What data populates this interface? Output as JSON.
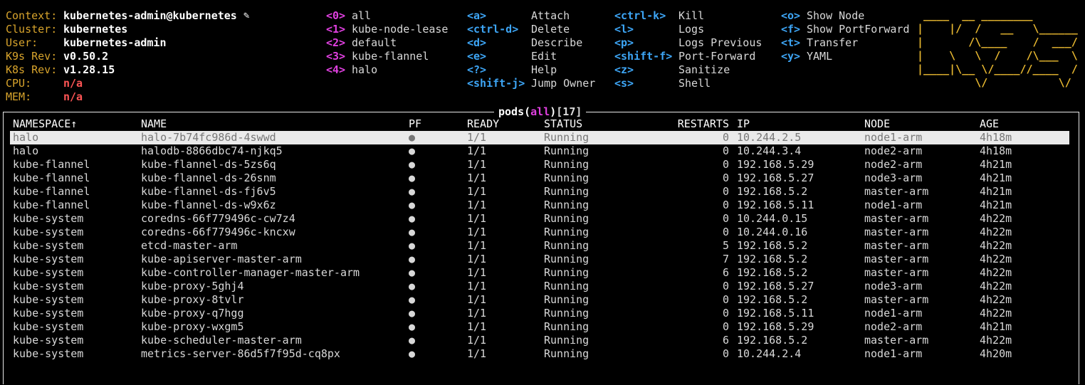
{
  "info": [
    {
      "label": "Context:",
      "value": "kubernetes-admin@kubernetes",
      "color": "white"
    },
    {
      "label": "Cluster:",
      "value": "kubernetes",
      "color": "white"
    },
    {
      "label": "User:",
      "value": "kubernetes-admin",
      "color": "white"
    },
    {
      "label": "K9s Rev:",
      "value": "v0.50.2",
      "color": "white"
    },
    {
      "label": "K8s Rev:",
      "value": "v1.28.15",
      "color": "white"
    },
    {
      "label": "CPU:",
      "value": "n/a",
      "color": "red"
    },
    {
      "label": "MEM:",
      "value": "n/a",
      "color": "red"
    }
  ],
  "icons": {
    "context_edit": "pencil-icon"
  },
  "namespaces": [
    {
      "key": "<0>",
      "name": "all"
    },
    {
      "key": "<1>",
      "name": "kube-node-lease"
    },
    {
      "key": "<2>",
      "name": "default"
    },
    {
      "key": "<3>",
      "name": "kube-flannel"
    },
    {
      "key": "<4>",
      "name": "halo"
    }
  ],
  "shortcuts_col1": [
    {
      "key": "<a>",
      "label": "Attach"
    },
    {
      "key": "<ctrl-d>",
      "label": "Delete"
    },
    {
      "key": "<d>",
      "label": "Describe"
    },
    {
      "key": "<e>",
      "label": "Edit"
    },
    {
      "key": "<?>",
      "label": "Help"
    },
    {
      "key": "<shift-j>",
      "label": "Jump Owner"
    }
  ],
  "shortcuts_col2": [
    {
      "key": "<ctrl-k>",
      "label": "Kill"
    },
    {
      "key": "<l>",
      "label": "Logs"
    },
    {
      "key": "<p>",
      "label": "Logs Previous"
    },
    {
      "key": "<shift-f>",
      "label": "Port-Forward"
    },
    {
      "key": "<z>",
      "label": "Sanitize"
    },
    {
      "key": "<s>",
      "label": "Shell"
    }
  ],
  "shortcuts_col3": [
    {
      "key": "<o>",
      "label": "Show Node"
    },
    {
      "key": "<f>",
      "label": "Show PortForward"
    },
    {
      "key": "<t>",
      "label": "Transfer"
    },
    {
      "key": "<y>",
      "label": "YAML"
    }
  ],
  "logo_lines": [
    " ____  __ ________       ",
    "|    |/  /   __   \\______",
    "|       /\\____    /  ___/",
    "|    \\   \\  /    /\\___  \\",
    "|____|\\__ \\/____//____  /",
    "         \\/           \\/ "
  ],
  "table": {
    "title_resource": "pods",
    "title_open": "(",
    "title_scope": "all",
    "title_close": ")",
    "title_count": "[17]",
    "sort_indicator": "↑",
    "columns": {
      "namespace": "NAMESPACE",
      "name": "NAME",
      "pf": "PF",
      "ready": "READY",
      "status": "STATUS",
      "restarts": "RESTARTS",
      "ip": "IP",
      "node": "NODE",
      "age": "AGE"
    },
    "selected_index": 0,
    "rows": [
      {
        "namespace": "halo",
        "name": "halo-7b74fc986d-4swwd",
        "pf": "●",
        "ready": "1/1",
        "status": "Running",
        "restarts": "0",
        "ip": "10.244.2.5",
        "node": "node1-arm",
        "age": "4h18m"
      },
      {
        "namespace": "halo",
        "name": "halodb-8866dbc74-njkq5",
        "pf": "●",
        "ready": "1/1",
        "status": "Running",
        "restarts": "0",
        "ip": "10.244.3.4",
        "node": "node2-arm",
        "age": "4h18m"
      },
      {
        "namespace": "kube-flannel",
        "name": "kube-flannel-ds-5zs6q",
        "pf": "●",
        "ready": "1/1",
        "status": "Running",
        "restarts": "0",
        "ip": "192.168.5.29",
        "node": "node2-arm",
        "age": "4h21m"
      },
      {
        "namespace": "kube-flannel",
        "name": "kube-flannel-ds-26snm",
        "pf": "●",
        "ready": "1/1",
        "status": "Running",
        "restarts": "0",
        "ip": "192.168.5.27",
        "node": "node3-arm",
        "age": "4h21m"
      },
      {
        "namespace": "kube-flannel",
        "name": "kube-flannel-ds-fj6v5",
        "pf": "●",
        "ready": "1/1",
        "status": "Running",
        "restarts": "0",
        "ip": "192.168.5.2",
        "node": "master-arm",
        "age": "4h21m"
      },
      {
        "namespace": "kube-flannel",
        "name": "kube-flannel-ds-w9x6z",
        "pf": "●",
        "ready": "1/1",
        "status": "Running",
        "restarts": "0",
        "ip": "192.168.5.11",
        "node": "node1-arm",
        "age": "4h21m"
      },
      {
        "namespace": "kube-system",
        "name": "coredns-66f779496c-cw7z4",
        "pf": "●",
        "ready": "1/1",
        "status": "Running",
        "restarts": "0",
        "ip": "10.244.0.15",
        "node": "master-arm",
        "age": "4h22m"
      },
      {
        "namespace": "kube-system",
        "name": "coredns-66f779496c-kncxw",
        "pf": "●",
        "ready": "1/1",
        "status": "Running",
        "restarts": "0",
        "ip": "10.244.0.16",
        "node": "master-arm",
        "age": "4h22m"
      },
      {
        "namespace": "kube-system",
        "name": "etcd-master-arm",
        "pf": "●",
        "ready": "1/1",
        "status": "Running",
        "restarts": "5",
        "ip": "192.168.5.2",
        "node": "master-arm",
        "age": "4h22m"
      },
      {
        "namespace": "kube-system",
        "name": "kube-apiserver-master-arm",
        "pf": "●",
        "ready": "1/1",
        "status": "Running",
        "restarts": "7",
        "ip": "192.168.5.2",
        "node": "master-arm",
        "age": "4h22m"
      },
      {
        "namespace": "kube-system",
        "name": "kube-controller-manager-master-arm",
        "pf": "●",
        "ready": "1/1",
        "status": "Running",
        "restarts": "6",
        "ip": "192.168.5.2",
        "node": "master-arm",
        "age": "4h22m"
      },
      {
        "namespace": "kube-system",
        "name": "kube-proxy-5ghj4",
        "pf": "●",
        "ready": "1/1",
        "status": "Running",
        "restarts": "0",
        "ip": "192.168.5.27",
        "node": "node3-arm",
        "age": "4h22m"
      },
      {
        "namespace": "kube-system",
        "name": "kube-proxy-8tvlr",
        "pf": "●",
        "ready": "1/1",
        "status": "Running",
        "restarts": "0",
        "ip": "192.168.5.2",
        "node": "master-arm",
        "age": "4h22m"
      },
      {
        "namespace": "kube-system",
        "name": "kube-proxy-q7hgg",
        "pf": "●",
        "ready": "1/1",
        "status": "Running",
        "restarts": "0",
        "ip": "192.168.5.11",
        "node": "node1-arm",
        "age": "4h22m"
      },
      {
        "namespace": "kube-system",
        "name": "kube-proxy-wxgm5",
        "pf": "●",
        "ready": "1/1",
        "status": "Running",
        "restarts": "0",
        "ip": "192.168.5.29",
        "node": "node2-arm",
        "age": "4h21m"
      },
      {
        "namespace": "kube-system",
        "name": "kube-scheduler-master-arm",
        "pf": "●",
        "ready": "1/1",
        "status": "Running",
        "restarts": "6",
        "ip": "192.168.5.2",
        "node": "master-arm",
        "age": "4h22m"
      },
      {
        "namespace": "kube-system",
        "name": "metrics-server-86d5f7f95d-cq8px",
        "pf": "●",
        "ready": "1/1",
        "status": "Running",
        "restarts": "0",
        "ip": "10.244.2.4",
        "node": "node1-arm",
        "age": "4h20m"
      }
    ]
  }
}
